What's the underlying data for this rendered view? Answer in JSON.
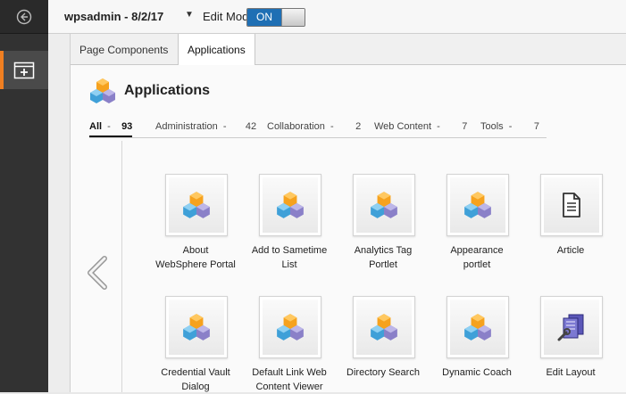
{
  "topbar": {
    "site_name": "wpsadmin - 8/2/17",
    "dropdown_glyph": "▼",
    "edit_mode_label": "Edit Mode:",
    "toggle_state": "ON"
  },
  "tabs": [
    {
      "label": "Page Components",
      "active": false
    },
    {
      "label": "Applications",
      "active": true
    }
  ],
  "section": {
    "title": "Applications",
    "icon": "cubes-icon"
  },
  "filters": [
    {
      "label": "All",
      "count": "93",
      "active": true
    },
    {
      "label": "Administration",
      "count": "42",
      "active": false
    },
    {
      "label": "Collaboration",
      "count": "2",
      "active": false
    },
    {
      "label": "Web Content",
      "count": "7",
      "active": false
    },
    {
      "label": "Tools",
      "count": "7",
      "active": false
    }
  ],
  "apps": [
    {
      "line1": "About",
      "line2": "WebSphere Portal",
      "icon": "cubes-icon"
    },
    {
      "line1": "Add to Sametime",
      "line2": "List",
      "icon": "cubes-icon"
    },
    {
      "line1": "Analytics Tag",
      "line2": "Portlet",
      "icon": "cubes-icon"
    },
    {
      "line1": "Appearance",
      "line2": "portlet",
      "icon": "cubes-icon"
    },
    {
      "line1": "Article",
      "line2": "",
      "icon": "document-icon"
    },
    {
      "line1": "Credential Vault",
      "line2": "Dialog",
      "icon": "cubes-icon"
    },
    {
      "line1": "Default Link Web",
      "line2": "Content Viewer",
      "icon": "cubes-icon"
    },
    {
      "line1": "Directory Search",
      "line2": "",
      "icon": "cubes-icon"
    },
    {
      "line1": "Dynamic Coach",
      "line2": "",
      "icon": "cubes-icon"
    },
    {
      "line1": "Edit Layout",
      "line2": "",
      "icon": "layout-tool-icon"
    }
  ]
}
